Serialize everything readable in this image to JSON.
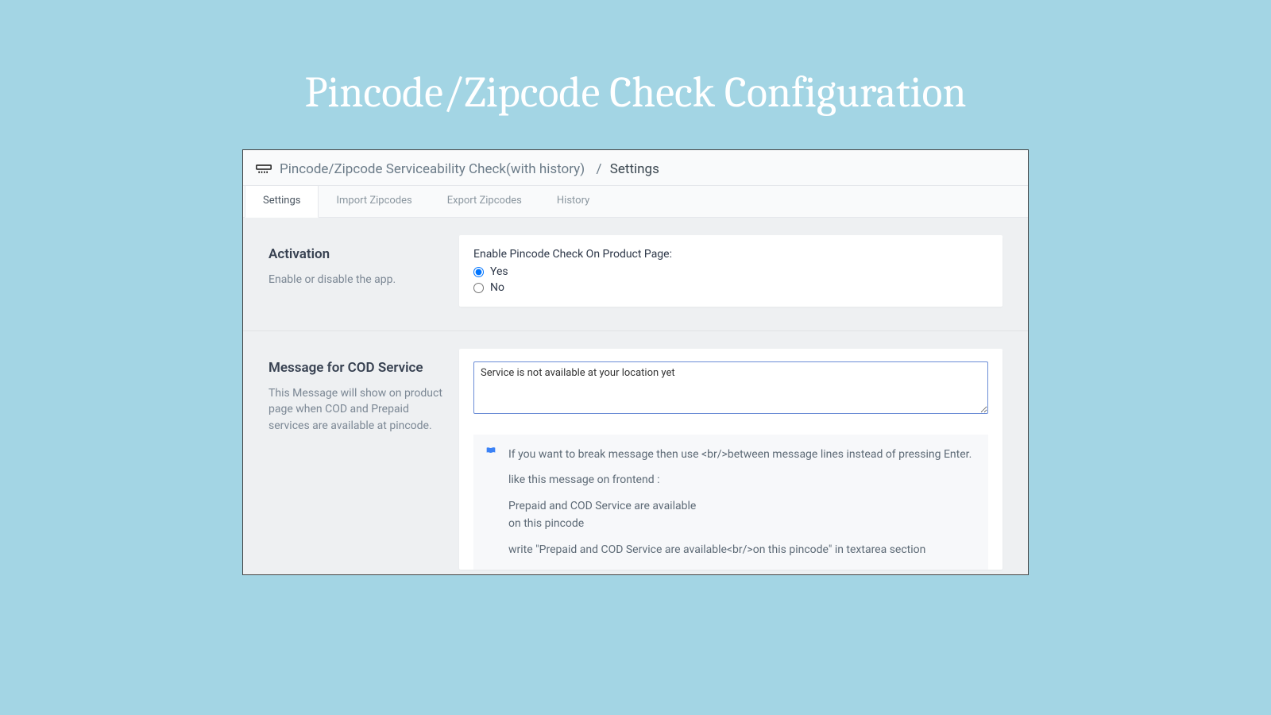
{
  "page_title": "Pincode/Zipcode Check Configuration",
  "breadcrumb": {
    "parent": "Pincode/Zipcode Serviceability Check(with history)",
    "current": "Settings"
  },
  "tabs": {
    "settings": "Settings",
    "import": "Import Zipcodes",
    "export": "Export Zipcodes",
    "history": "History"
  },
  "activation": {
    "title": "Activation",
    "desc": "Enable or disable the app.",
    "field_label": "Enable Pincode Check On Product Page:",
    "yes": "Yes",
    "no": "No"
  },
  "cod": {
    "title": "Message for COD Service",
    "desc": "This Message will show on product page when COD and Prepaid services are available at pincode.",
    "textarea_value": "Service is not available at your location yet",
    "hint1": "If you want to break message then use <br/>between message lines instead of pressing Enter.",
    "hint2": "like this message on frontend :",
    "hint3a": "Prepaid and COD Service are available",
    "hint3b": "on this pincode",
    "hint4": "write \"Prepaid and COD Service are available<br/>on this pincode\" in textarea section"
  }
}
